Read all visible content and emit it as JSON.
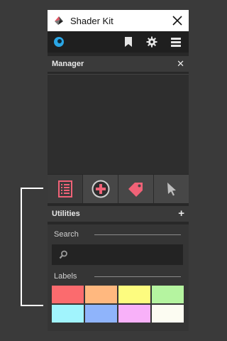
{
  "window": {
    "title": "Shader Kit",
    "close_icon": "close-icon"
  },
  "toolbar": {
    "icons": [
      "logo-dot-icon",
      "bookmark-icon",
      "gear-icon",
      "stack-icon"
    ],
    "accent": "#2aa6e6"
  },
  "manager": {
    "title": "Manager",
    "close_symbol": "✕"
  },
  "tabs": [
    {
      "icon": "list-icon",
      "active": true,
      "color": "#f06277"
    },
    {
      "icon": "add-circle-icon",
      "active": false,
      "color": "#f06277"
    },
    {
      "icon": "tag-icon",
      "active": false,
      "color": "#f06277"
    },
    {
      "icon": "cursor-icon",
      "active": false,
      "color": "#bdbdbd"
    }
  ],
  "utilities": {
    "title": "Utilities",
    "add_symbol": "+",
    "search_label": "Search",
    "search_value": "",
    "labels_label": "Labels"
  },
  "swatches": [
    {
      "color": "#fb6b6e"
    },
    {
      "color": "#ffb87f"
    },
    {
      "color": "#fdfc7f"
    },
    {
      "color": "#b5f4a0"
    },
    {
      "color": "#a1f4fd"
    },
    {
      "color": "#8fb4fb"
    },
    {
      "color": "#f8b1f9"
    },
    {
      "color": "#fcfcf2"
    }
  ]
}
